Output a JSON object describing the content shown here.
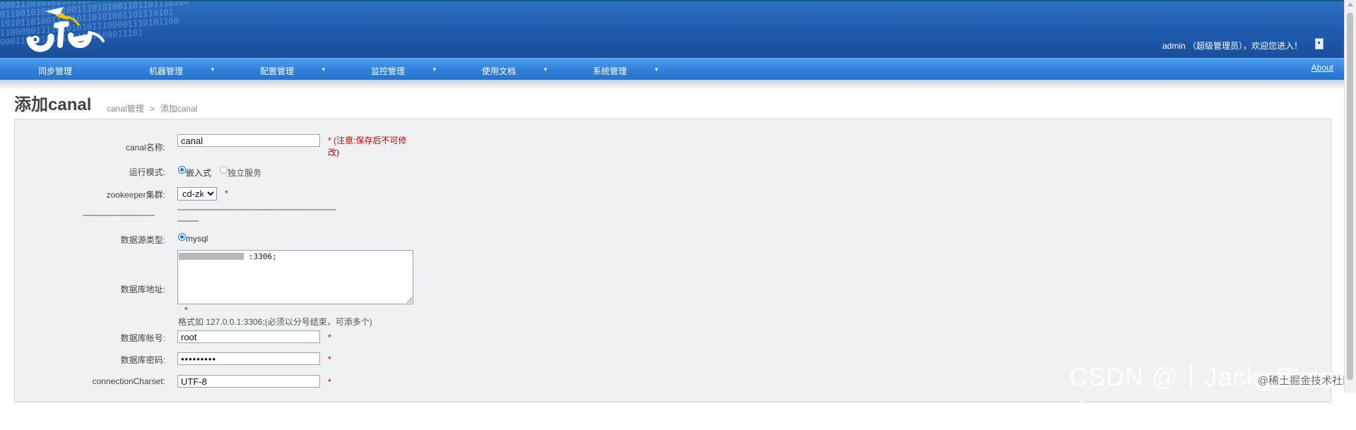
{
  "header": {
    "welcome_text": "admin （超级管理员），欢迎您进入！",
    "binary_text": "000111010101101110101000111011101101110\n0110010101101001110101001101101110100\n1010110100111010110101001101110101\n11000001111010101011100001110101100\n0001111010101101110100011101"
  },
  "nav": {
    "items": [
      {
        "label": "同步管理",
        "has_dropdown": false
      },
      {
        "label": "机器管理",
        "has_dropdown": true
      },
      {
        "label": "配置管理",
        "has_dropdown": true
      },
      {
        "label": "监控管理",
        "has_dropdown": true
      },
      {
        "label": "使用文档",
        "has_dropdown": true
      },
      {
        "label": "系统管理",
        "has_dropdown": true
      }
    ],
    "dropdown_glyph": "▼",
    "about_label": "About"
  },
  "page": {
    "title": "添加canal",
    "breadcrumb": [
      "canal管理",
      "添加canal"
    ],
    "breadcrumb_sep": ">"
  },
  "form": {
    "canal_name": {
      "label": "canal名称:",
      "value": "canal",
      "required_mark": "*",
      "note_line1": "* (注意:保存后不可修",
      "note_line2": "改)"
    },
    "run_mode": {
      "label": "运行模式:",
      "options": [
        {
          "label": "嵌入式",
          "checked": true
        },
        {
          "label": "独立服务",
          "checked": false
        }
      ]
    },
    "zookeeper": {
      "label": "zookeeper集群:",
      "selected": "cd-zk",
      "required_mark": "*"
    },
    "separator_left": "--------------------------------------",
    "separator_right_line1": "------------------------------------------------------------------------------------",
    "separator_right_line2": "-----------",
    "datasource_type": {
      "label": "数据源类型:",
      "options": [
        {
          "label": "mysql",
          "checked": true
        }
      ]
    },
    "db_address": {
      "label": "数据库地址:",
      "value": ":3306;",
      "required_mark": "*",
      "hint": "格式如 127.0.0.1:3306;(必须以分号结束，可添多个)"
    },
    "db_account": {
      "label": "数据库帐号:",
      "value": "root",
      "required_mark": "*"
    },
    "db_password": {
      "label": "数据库密码:",
      "value": "•••••••••",
      "required_mark": "*"
    },
    "charset": {
      "label": "connectionCharset:",
      "value": "UTF-8",
      "required_mark": "*"
    }
  },
  "watermark": {
    "csdn": "CSDN @丨Jack_Chen丨",
    "juejin": "@稀土掘金技术社区"
  }
}
